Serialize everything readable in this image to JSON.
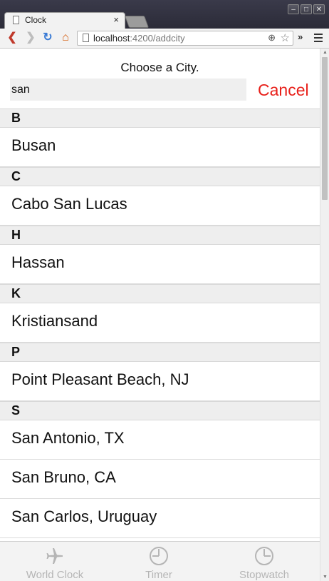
{
  "browser": {
    "tab_title": "Clock",
    "tab_close": "×",
    "url_host": "localhost",
    "url_path": ":4200/addcity",
    "extensions_chevron": "»"
  },
  "header": {
    "title": "Choose a City.",
    "search_value": "san",
    "cancel_label": "Cancel"
  },
  "groups": [
    {
      "letter": "B",
      "cities": [
        "Busan"
      ]
    },
    {
      "letter": "C",
      "cities": [
        "Cabo San Lucas"
      ]
    },
    {
      "letter": "H",
      "cities": [
        "Hassan"
      ]
    },
    {
      "letter": "K",
      "cities": [
        "Kristiansand"
      ]
    },
    {
      "letter": "P",
      "cities": [
        "Point Pleasant Beach, NJ"
      ]
    },
    {
      "letter": "S",
      "cities": [
        "San Antonio, TX",
        "San Bruno, CA",
        "San Carlos, Uruguay"
      ]
    }
  ],
  "nav": {
    "items": [
      {
        "label": "World Clock",
        "icon": "airplane-icon"
      },
      {
        "label": "Timer",
        "icon": "timer-icon"
      },
      {
        "label": "Stopwatch",
        "icon": "stopwatch-icon"
      }
    ]
  },
  "colors": {
    "cancel": "#e8201a",
    "nav_inactive": "#b5b5b5",
    "letter_header_bg": "#eeeeee",
    "search_bg": "#efefef"
  }
}
